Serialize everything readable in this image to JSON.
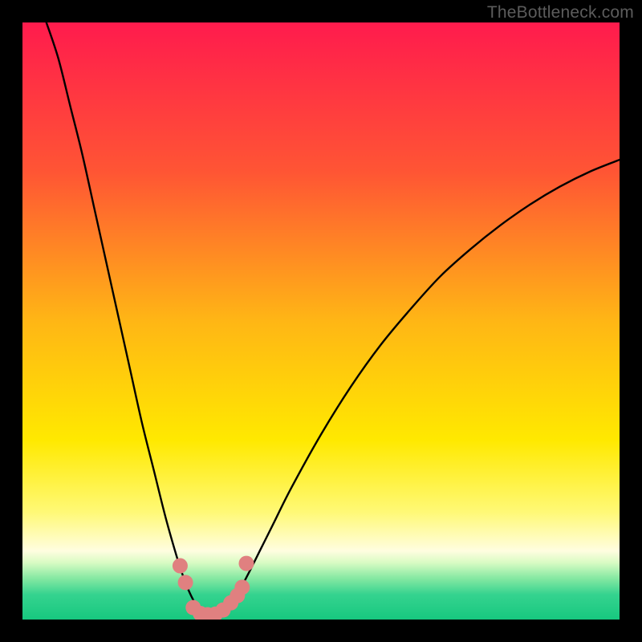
{
  "watermark": "TheBottleneck.com",
  "chart_data": {
    "type": "line",
    "title": "",
    "xlabel": "",
    "ylabel": "",
    "xlim": [
      0,
      100
    ],
    "ylim": [
      0,
      100
    ],
    "grid": false,
    "legend": false,
    "background_gradient": {
      "stops": [
        {
          "pos": 0.0,
          "color": "#ff1b4d"
        },
        {
          "pos": 0.25,
          "color": "#ff5534"
        },
        {
          "pos": 0.5,
          "color": "#ffb615"
        },
        {
          "pos": 0.7,
          "color": "#ffe900"
        },
        {
          "pos": 0.82,
          "color": "#fff976"
        },
        {
          "pos": 0.885,
          "color": "#fffde0"
        },
        {
          "pos": 0.905,
          "color": "#d8fbc3"
        },
        {
          "pos": 0.93,
          "color": "#88e9a3"
        },
        {
          "pos": 0.958,
          "color": "#35d38f"
        },
        {
          "pos": 1.0,
          "color": "#17c87f"
        }
      ]
    },
    "curve": {
      "x": [
        4,
        6,
        8,
        10,
        12,
        14,
        16,
        18,
        20,
        22,
        24,
        26,
        27,
        28,
        29,
        30,
        31,
        32,
        33,
        34,
        35,
        36,
        38,
        40,
        42,
        45,
        50,
        55,
        60,
        65,
        70,
        75,
        80,
        85,
        90,
        95,
        100
      ],
      "y": [
        100,
        94,
        86,
        78,
        69,
        60,
        51,
        42,
        33,
        25,
        17,
        10,
        7,
        4.5,
        2.6,
        1.4,
        0.7,
        0.4,
        0.7,
        1.4,
        2.6,
        4.2,
        8,
        12,
        16,
        22,
        31,
        39,
        46,
        52,
        57.5,
        62,
        66,
        69.5,
        72.5,
        75,
        77
      ]
    },
    "markers": {
      "color": "#e08080",
      "points": [
        {
          "x": 26.4,
          "y": 9.0
        },
        {
          "x": 27.3,
          "y": 6.2
        },
        {
          "x": 28.6,
          "y": 2.0
        },
        {
          "x": 29.8,
          "y": 1.0
        },
        {
          "x": 31.0,
          "y": 0.8
        },
        {
          "x": 32.3,
          "y": 0.9
        },
        {
          "x": 33.6,
          "y": 1.6
        },
        {
          "x": 34.9,
          "y": 2.8
        },
        {
          "x": 36.0,
          "y": 4.0
        },
        {
          "x": 36.8,
          "y": 5.4
        },
        {
          "x": 37.5,
          "y": 9.4
        }
      ]
    }
  }
}
